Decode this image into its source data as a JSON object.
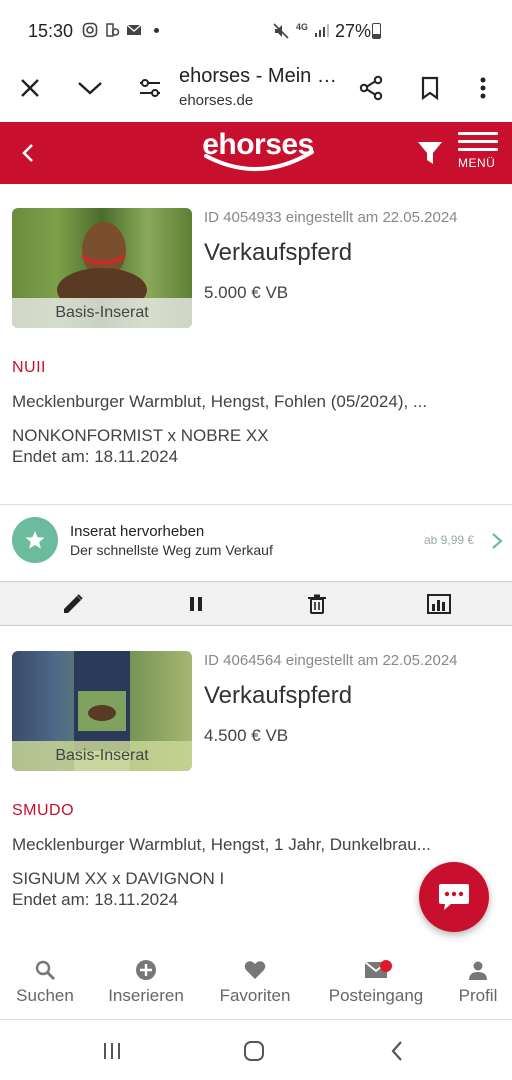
{
  "status_bar": {
    "time": "15:30",
    "battery": "27%",
    "network": "4G"
  },
  "browser": {
    "title": "ehorses - Mein …",
    "url": "ehorses.de",
    "icons": [
      "close-icon",
      "chevron-down-icon",
      "site-settings-icon",
      "share-icon",
      "bookmark-icon",
      "more-vert-icon"
    ]
  },
  "app_header": {
    "logo": "ehorses",
    "menu_label": "MENÜ",
    "brand_color": "#c8102e"
  },
  "listings": [
    {
      "id_line": "ID 4054933 eingestellt am 22.05.2024",
      "title": "Verkaufspferd",
      "price": "5.000 € VB",
      "thumb_label": "Basis-Inserat",
      "name": "NUII",
      "description": "Mecklenburger Warmblut, Hengst, Fohlen (05/2024), ...",
      "pedigree": "NONKONFORMIST x NOBRE XX",
      "ends": "Endet am: 18.11.2024"
    },
    {
      "id_line": "ID 4064564 eingestellt am 22.05.2024",
      "title": "Verkaufspferd",
      "price": "4.500 € VB",
      "thumb_label": "Basis-Inserat",
      "name": "SMUDO",
      "description": "Mecklenburger Warmblut, Hengst, 1 Jahr, Dunkelbrau...",
      "pedigree": "SIGNUM XX x DAVIGNON I",
      "ends": "Endet am: 18.11.2024"
    }
  ],
  "highlight": {
    "title": "Inserat hervorheben",
    "subtitle": "Der schnellste Weg zum Verkauf",
    "price": "ab 9,99 €",
    "accent": "#6bbb9f"
  },
  "actions": [
    "edit-icon",
    "pause-icon",
    "delete-icon",
    "statistics-icon"
  ],
  "bottom_nav": {
    "items": [
      {
        "label": "Suchen",
        "icon": "search-icon"
      },
      {
        "label": "Inserieren",
        "icon": "add-circle-icon"
      },
      {
        "label": "Favoriten",
        "icon": "heart-icon"
      },
      {
        "label": "Posteingang",
        "icon": "mail-icon"
      },
      {
        "label": "Profil",
        "icon": "person-icon"
      }
    ]
  }
}
